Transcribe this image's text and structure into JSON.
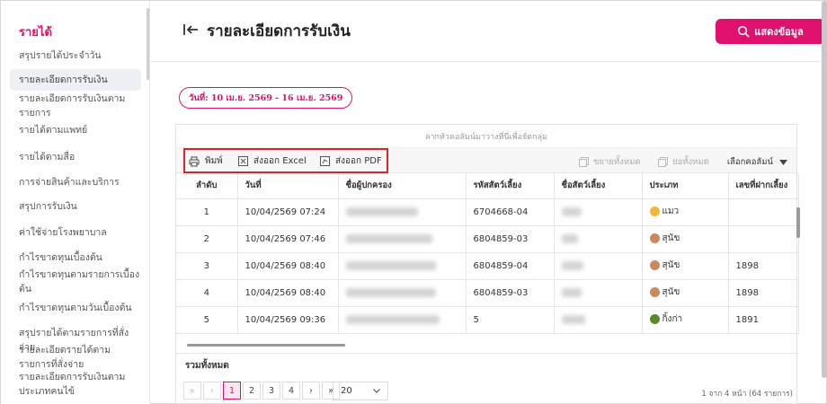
{
  "sidebar": {
    "header": "รายได้",
    "items": [
      {
        "label": "สรุปรายได้ประจำวัน"
      },
      {
        "label": "รายละเอียดการรับเงิน"
      },
      {
        "label": "รายละเอียดการรับเงินตามรายการ"
      },
      {
        "label": "รายได้ตามแพทย์"
      },
      {
        "label": "รายได้ตามสื่อ"
      },
      {
        "label": "การจ่ายสินค้าและบริการ"
      },
      {
        "label": "สรุปการรับเงิน"
      },
      {
        "label": "ค่าใช้จ่ายโรงพยาบาล"
      },
      {
        "label": "กำไรขาดทุนเบื้องต้น"
      },
      {
        "label": "กำไรขาดทุนตามรายการเบื้องต้น"
      },
      {
        "label": "กำไรขาดทุนตามวันเบื้องต้น"
      },
      {
        "label": "สรุปรายได้ตามรายการที่สั่งจ่าย"
      },
      {
        "label": "รายละเอียดรายได้ตามรายการที่สั่งจ่าย"
      },
      {
        "label": "รายละเอียดการรับเงินตามประเภทคนไข้"
      }
    ],
    "active_index": 1
  },
  "header": {
    "title": "รายละเอียดการรับเงิน",
    "show_button": "แสดงข้อมูล"
  },
  "date_range": "วันที่: 10 เม.ย. 2569 - 16 เม.ย. 2569",
  "grid": {
    "group_hint": "ลากหัวคอลัมน์มาวางที่นี่เพื่อจัดกลุ่ม",
    "toolbar": {
      "print": "พิมพ์",
      "export_excel": "ส่งออก Excel",
      "export_pdf": "ส่งออก PDF",
      "expand_all": "ขยายทั้งหมด",
      "collapse_all": "ย่อทั้งหมด",
      "choose_columns": "เลือกคอลัมน์"
    },
    "columns": [
      "ลำดับ",
      "วันที่",
      "ชื่อผู้ปกครอง",
      "รหัสสัตว์เลี้ยง",
      "ชื่อสัตว์เลี้ยง",
      "ประเภท",
      "เลขที่ฝากเลี้ยง"
    ],
    "rows": [
      {
        "no": "1",
        "date": "10/04/2569 07:24",
        "pet_code": "6704668-04",
        "type": "แมว",
        "type_icon": "cat-icon",
        "deposit": ""
      },
      {
        "no": "2",
        "date": "10/04/2569 07:46",
        "pet_code": "6804859-03",
        "type": "สุนัข",
        "type_icon": "dog-icon",
        "deposit": ""
      },
      {
        "no": "3",
        "date": "10/04/2569 08:40",
        "pet_code": "6804859-04",
        "type": "สุนัข",
        "type_icon": "dog-icon",
        "deposit": "1898"
      },
      {
        "no": "4",
        "date": "10/04/2569 08:40",
        "pet_code": "6804859-03",
        "type": "สุนัข",
        "type_icon": "dog-icon",
        "deposit": "1898"
      },
      {
        "no": "5",
        "date": "10/04/2569 09:36",
        "pet_code": "5",
        "type": "กิ้งก่า",
        "type_icon": "lizard-icon",
        "deposit": "1891"
      }
    ],
    "total_label": "รวมทั้งหมด",
    "pager": {
      "first": "«",
      "prev": "‹",
      "pages": [
        "1",
        "2",
        "3",
        "4"
      ],
      "current": "1",
      "next": "›",
      "last": "»",
      "page_size": "20",
      "info": "1 จาก 4 หน้า (64 รายการ)"
    }
  },
  "colors": {
    "accent": "#e0106e",
    "highlight_border": "#d9242a"
  }
}
